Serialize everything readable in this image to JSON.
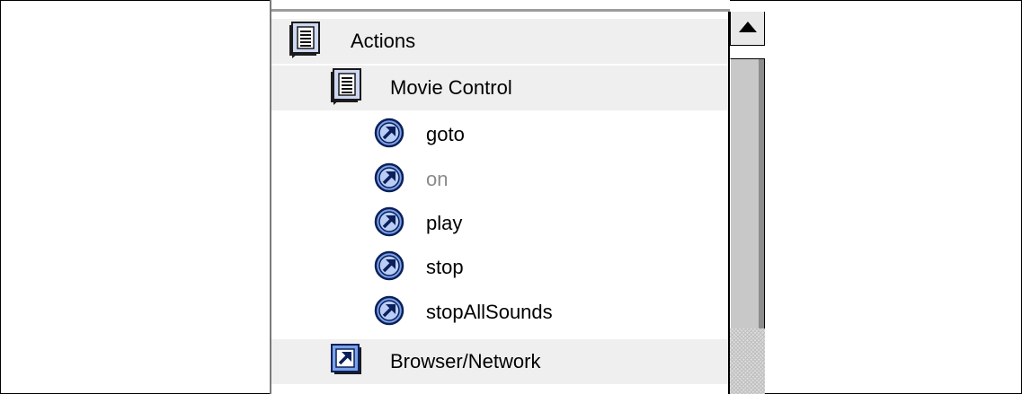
{
  "tree": {
    "items": [
      {
        "label": "Actions",
        "kind": "folder",
        "level": 0,
        "disabled": false,
        "icon": "book-icon"
      },
      {
        "label": "Movie Control",
        "kind": "folder",
        "level": 1,
        "disabled": false,
        "icon": "book-icon"
      },
      {
        "label": "goto",
        "kind": "action",
        "level": 2,
        "disabled": false,
        "icon": "action-arrow-icon"
      },
      {
        "label": "on",
        "kind": "action",
        "level": 2,
        "disabled": true,
        "icon": "action-arrow-icon"
      },
      {
        "label": "play",
        "kind": "action",
        "level": 2,
        "disabled": false,
        "icon": "action-arrow-icon"
      },
      {
        "label": "stop",
        "kind": "action",
        "level": 2,
        "disabled": false,
        "icon": "action-arrow-icon"
      },
      {
        "label": "stopAllSounds",
        "kind": "action",
        "level": 2,
        "disabled": false,
        "icon": "action-arrow-icon"
      },
      {
        "label": "Browser/Network",
        "kind": "category",
        "level": 1,
        "disabled": false,
        "icon": "category-arrow-icon"
      }
    ]
  },
  "scrollbar": {
    "up_icon": "triangle-up-icon"
  },
  "colors": {
    "icon_blue": "#7aa2e8",
    "icon_dark": "#0b1f5a",
    "disabled_text": "#8a8a8a",
    "shaded_row": "#efefef"
  }
}
